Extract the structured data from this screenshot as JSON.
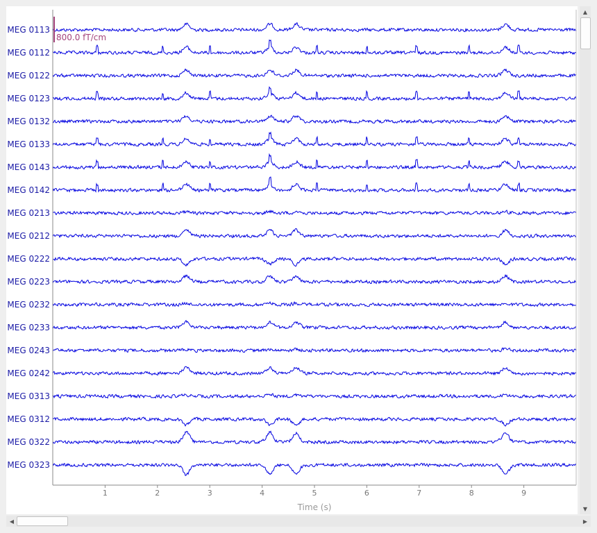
{
  "chart_data": {
    "type": "line",
    "xlabel": "Time (s)",
    "xlim": [
      0,
      10
    ],
    "x_ticks": [
      "1",
      "2",
      "3",
      "4",
      "5",
      "6",
      "7",
      "8",
      "9"
    ],
    "scale_bar_label": "800.0 fT/cm",
    "channels": [
      "MEG 0113",
      "MEG 0112",
      "MEG 0122",
      "MEG 0123",
      "MEG 0132",
      "MEG 0133",
      "MEG 0143",
      "MEG 0142",
      "MEG 0213",
      "MEG 0212",
      "MEG 0222",
      "MEG 0223",
      "MEG 0232",
      "MEG 0233",
      "MEG 0243",
      "MEG 0242",
      "MEG 0313",
      "MEG 0312",
      "MEG 0322",
      "MEG 0323"
    ],
    "blink_times": [
      2.55,
      4.15,
      4.65,
      8.65
    ],
    "spike_times": [
      0.85,
      2.1,
      3.0,
      4.15,
      5.05,
      6.0,
      6.95,
      7.95,
      8.9
    ],
    "line_color": "#0000e0",
    "scale_color": "#a4447b"
  }
}
